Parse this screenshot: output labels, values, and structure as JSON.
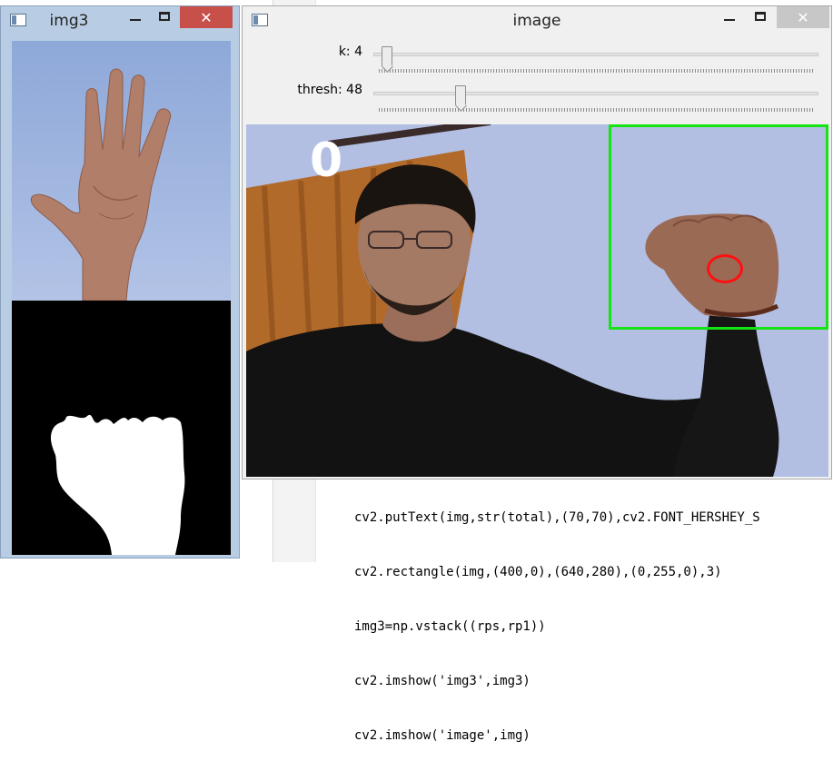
{
  "editor": {
    "top_line": "                ( ...  [ ], ) ,",
    "lines": [
      "cv2.putText(img,str(total),(70,70),cv2.FONT_HERSHEY_S",
      "cv2.rectangle(img,(400,0),(640,280),(0,255,0),3)",
      "img3=np.vstack((rps,rp1))",
      "cv2.imshow('img3',img3)",
      "cv2.imshow('image',img)"
    ]
  },
  "windows": {
    "img3": {
      "title": "img3",
      "close_glyph": "✕"
    },
    "image": {
      "title": "image",
      "close_glyph": "✕",
      "trackbars": [
        {
          "label": "k: 4",
          "value": 4,
          "max": 255
        },
        {
          "label": "thresh: 48",
          "value": 48,
          "max": 255
        }
      ],
      "overlay_text": "0"
    }
  },
  "colors": {
    "roi_box": "#14e314",
    "circle": "#ff1010",
    "img3_close": "#c7504b"
  }
}
